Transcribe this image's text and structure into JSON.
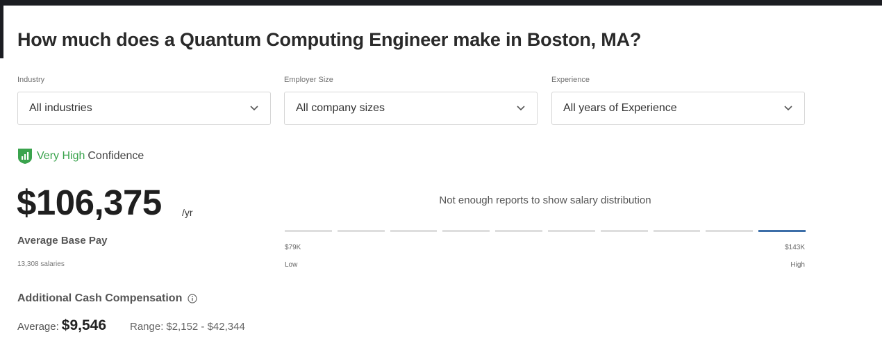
{
  "header": {
    "title": "How much does a Quantum Computing Engineer make in Boston, MA?"
  },
  "filters": [
    {
      "label": "Industry",
      "value": "All industries",
      "icon": "chevron-down-icon"
    },
    {
      "label": "Employer Size",
      "value": "All company sizes",
      "icon": "chevron-down-icon"
    },
    {
      "label": "Experience",
      "value": "All years of Experience",
      "icon": "chevron-down-icon"
    }
  ],
  "confidence": {
    "level": "Very High",
    "suffix": "Confidence",
    "color": "#3aa34d",
    "icon": "shield-signal-icon"
  },
  "pay": {
    "amount": "$106,375",
    "unit": "/yr",
    "label": "Average Base Pay",
    "count": "13,308 salaries"
  },
  "distribution": {
    "message": "Not enough reports to show salary distribution",
    "low_value": "$79K",
    "low_label": "Low",
    "high_value": "$143K",
    "high_label": "High",
    "active_color": "#3c6ea8",
    "active_bucket": 9,
    "bucket_count": 10
  },
  "cash": {
    "title": "Additional Cash Compensation",
    "info_icon": "info-icon",
    "average_label": "Average:",
    "average_value": "$9,546",
    "range_label": "Range:",
    "range_value": "$2,152 - $42,344"
  }
}
